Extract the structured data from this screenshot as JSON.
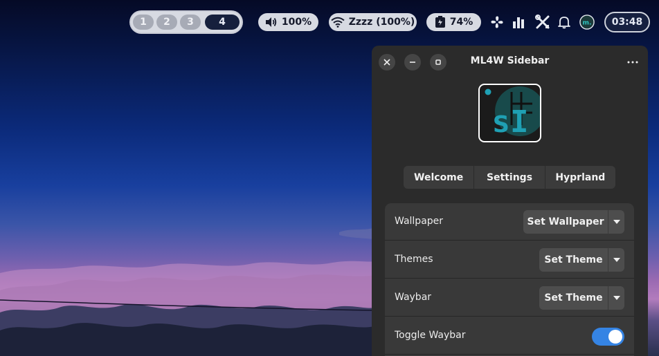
{
  "topbar": {
    "workspaces": [
      "1",
      "2",
      "3",
      "4"
    ],
    "active_workspace": "4",
    "volume": "100%",
    "wifi": "Zzzz (100%)",
    "battery": "74%",
    "clock": "03:48",
    "icons": [
      "volume-icon",
      "wifi-icon",
      "battery-icon",
      "fan-icon",
      "chart-bars-icon",
      "tools-icon",
      "bell-icon",
      "ml4w-icon"
    ]
  },
  "sidebar": {
    "title": "ML4W Sidebar",
    "logo_text": "sI",
    "tabs": [
      "Welcome",
      "Settings",
      "Hyprland"
    ],
    "rows": [
      {
        "label": "Wallpaper",
        "button": "Set Wallpaper"
      },
      {
        "label": "Themes",
        "button": "Set Theme"
      },
      {
        "label": "Waybar",
        "button": "Set Theme"
      },
      {
        "label": "Toggle Waybar",
        "toggle_on": true
      }
    ]
  },
  "colors": {
    "accent": "#3584e4",
    "logo_teal": "#1fa0b4",
    "window_bg": "#2b2b2b"
  }
}
